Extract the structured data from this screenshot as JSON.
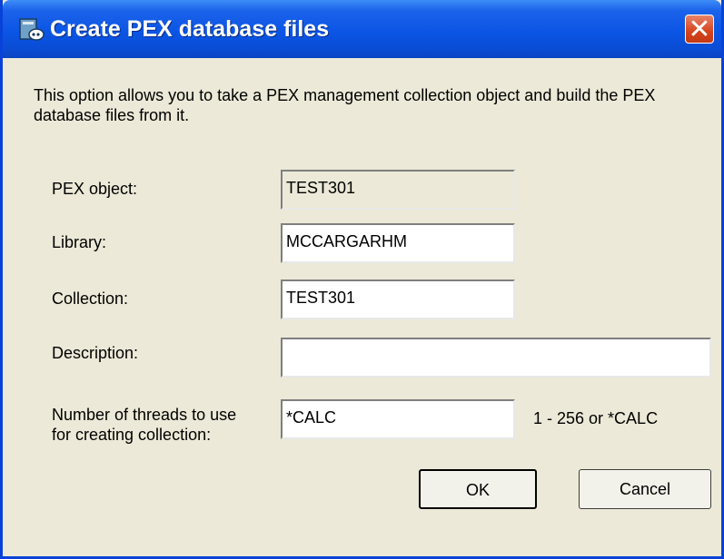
{
  "window": {
    "title": "Create PEX database files",
    "close_label": "✕"
  },
  "description": "This option allows you to take a PEX management collection object and build the PEX database files from it.",
  "form": {
    "pex_object": {
      "label": "PEX object:",
      "value": "TEST301"
    },
    "library": {
      "label": "Library:",
      "value": "MCCARGARHM"
    },
    "collection": {
      "label": "Collection:",
      "value": "TEST301"
    },
    "description": {
      "label": "Description:",
      "value": ""
    },
    "threads": {
      "label": "Number of threads to use for creating collection:",
      "value": "*CALC",
      "hint": "1 - 256 or *CALC"
    }
  },
  "buttons": {
    "ok": "OK",
    "cancel": "Cancel"
  },
  "icons": {
    "title": "database-window-icon",
    "close": "close-icon"
  },
  "colors": {
    "titlebar": "#0b55e5",
    "dialog_bg": "#ece9d8",
    "close_button": "#d4441e"
  }
}
